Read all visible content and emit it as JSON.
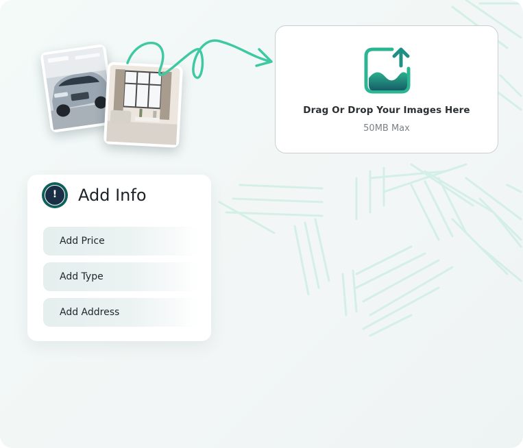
{
  "upload": {
    "title": "Drag Or Drop Your Images Here",
    "limit": "50MB Max",
    "icon": "image-upload-icon"
  },
  "info": {
    "title": "Add Info",
    "icon_glyph": "!",
    "fields": [
      {
        "label": "Add Price"
      },
      {
        "label": "Add Type"
      },
      {
        "label": "Add Address"
      }
    ]
  },
  "colors": {
    "accent": "#3ec9a3",
    "brand_dark": "#0f5f5a",
    "icon_navy": "#1a2f46"
  }
}
